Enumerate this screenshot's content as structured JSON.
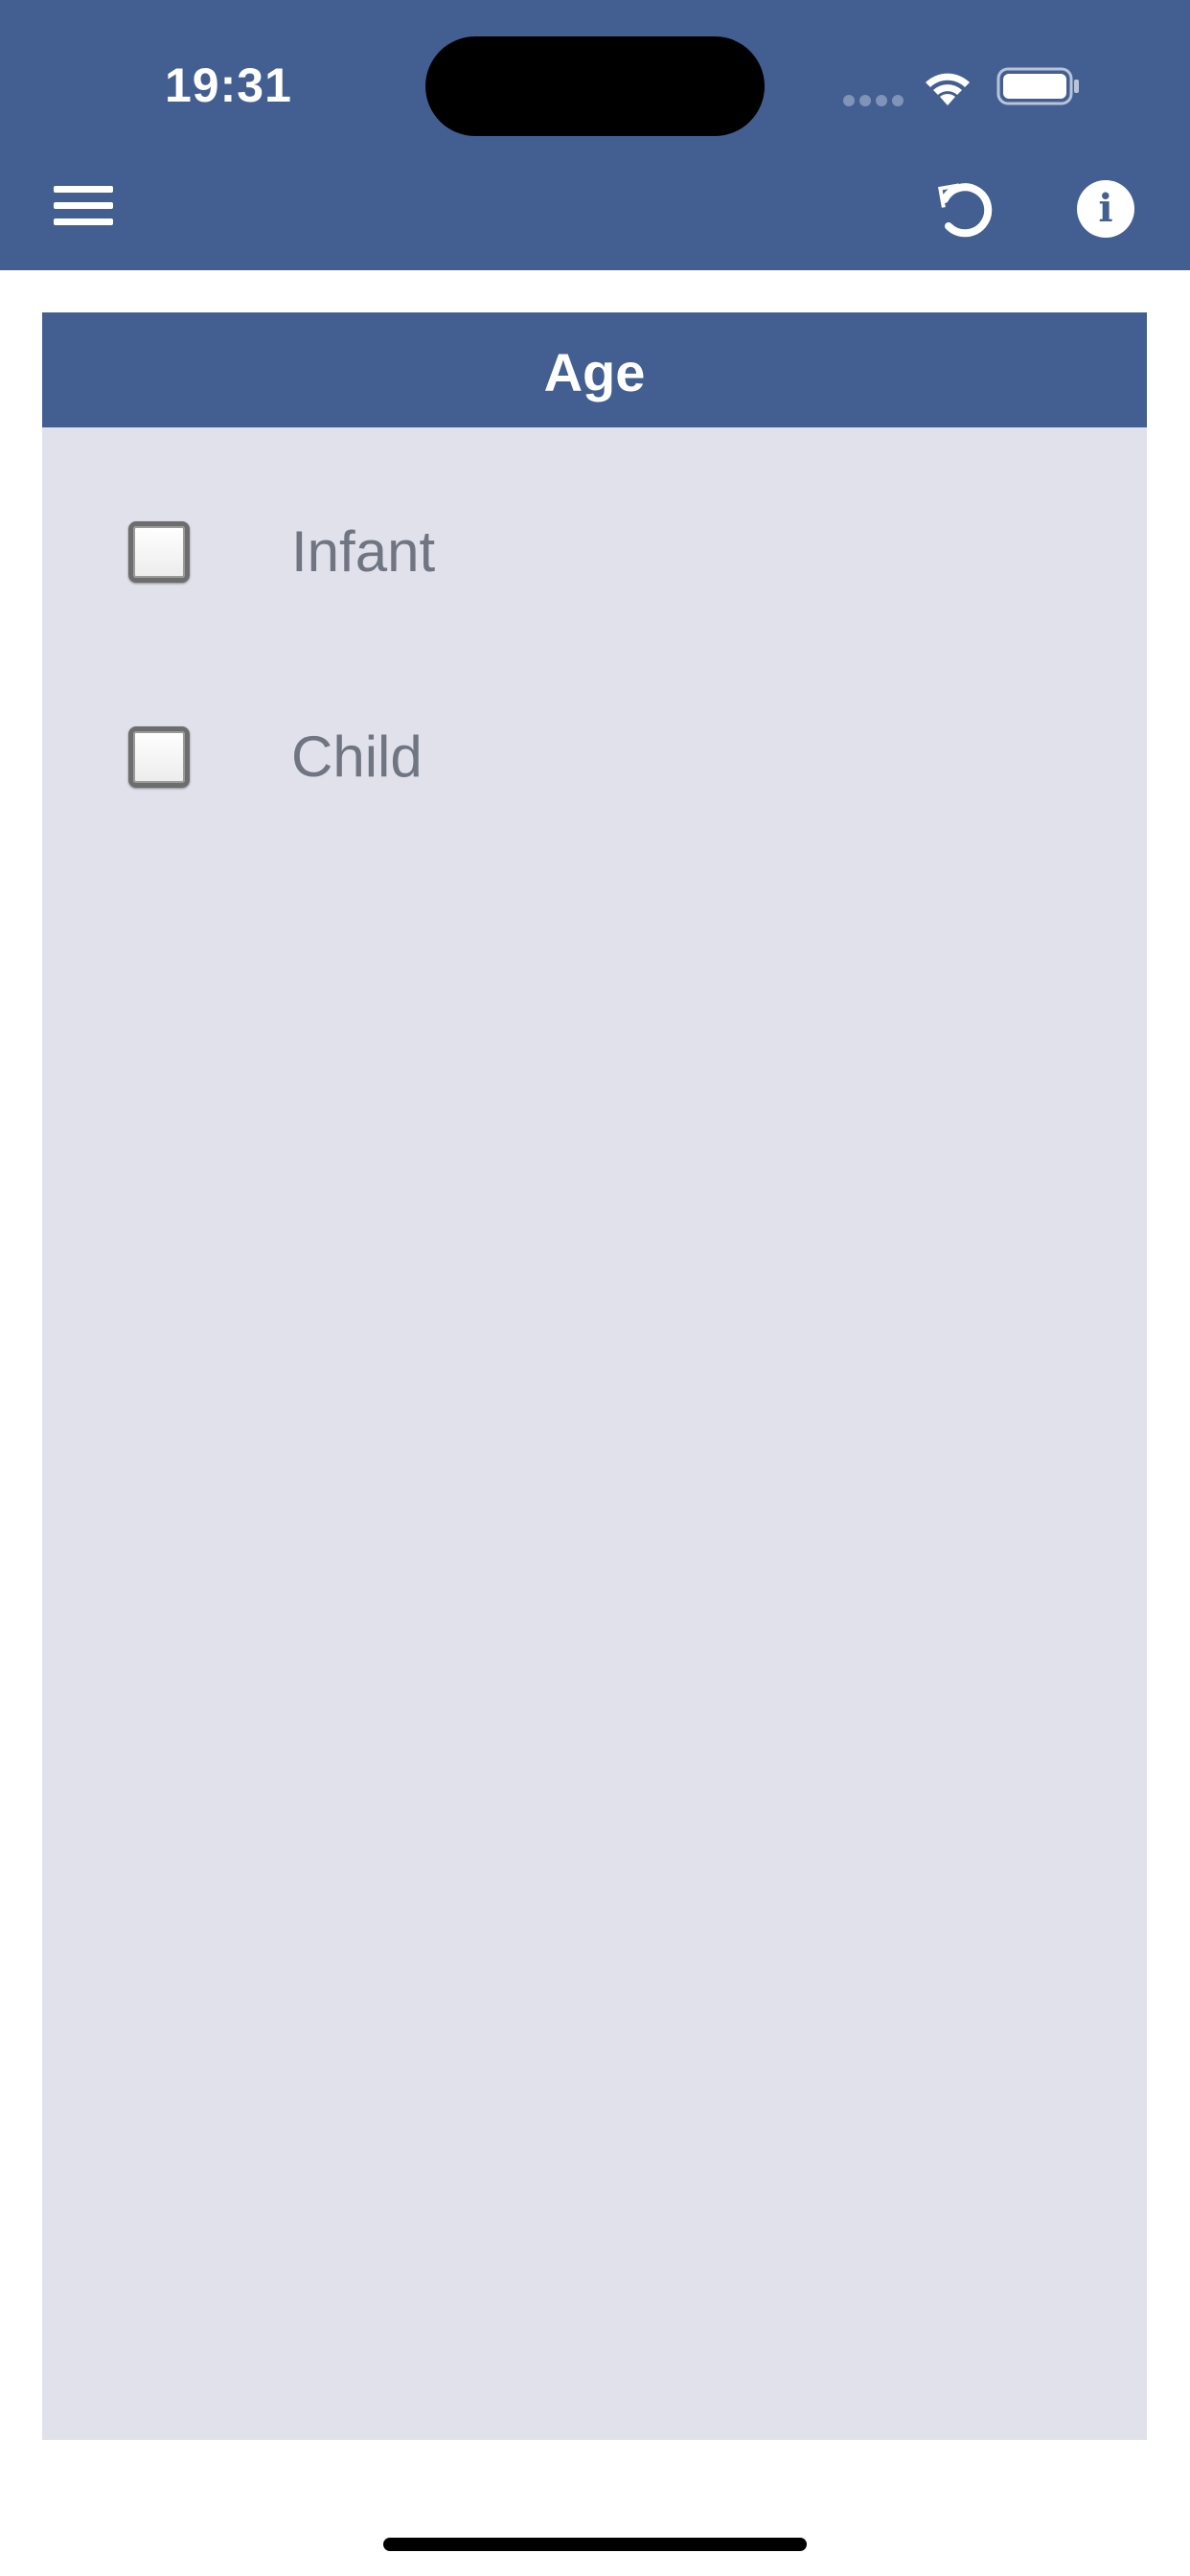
{
  "status_bar": {
    "time": "19:31"
  },
  "toolbar": {
    "menu_icon": "hamburger-menu-icon",
    "reset_icon": "undo-icon",
    "info_icon": "info-icon",
    "info_glyph": "i"
  },
  "panel": {
    "title": "Age",
    "options": [
      {
        "label": "Infant",
        "checked": false
      },
      {
        "label": "Child",
        "checked": false
      }
    ]
  },
  "colors": {
    "header": "#435f91",
    "panel_background": "#e1e1ec",
    "label_text": "#6f7581"
  }
}
